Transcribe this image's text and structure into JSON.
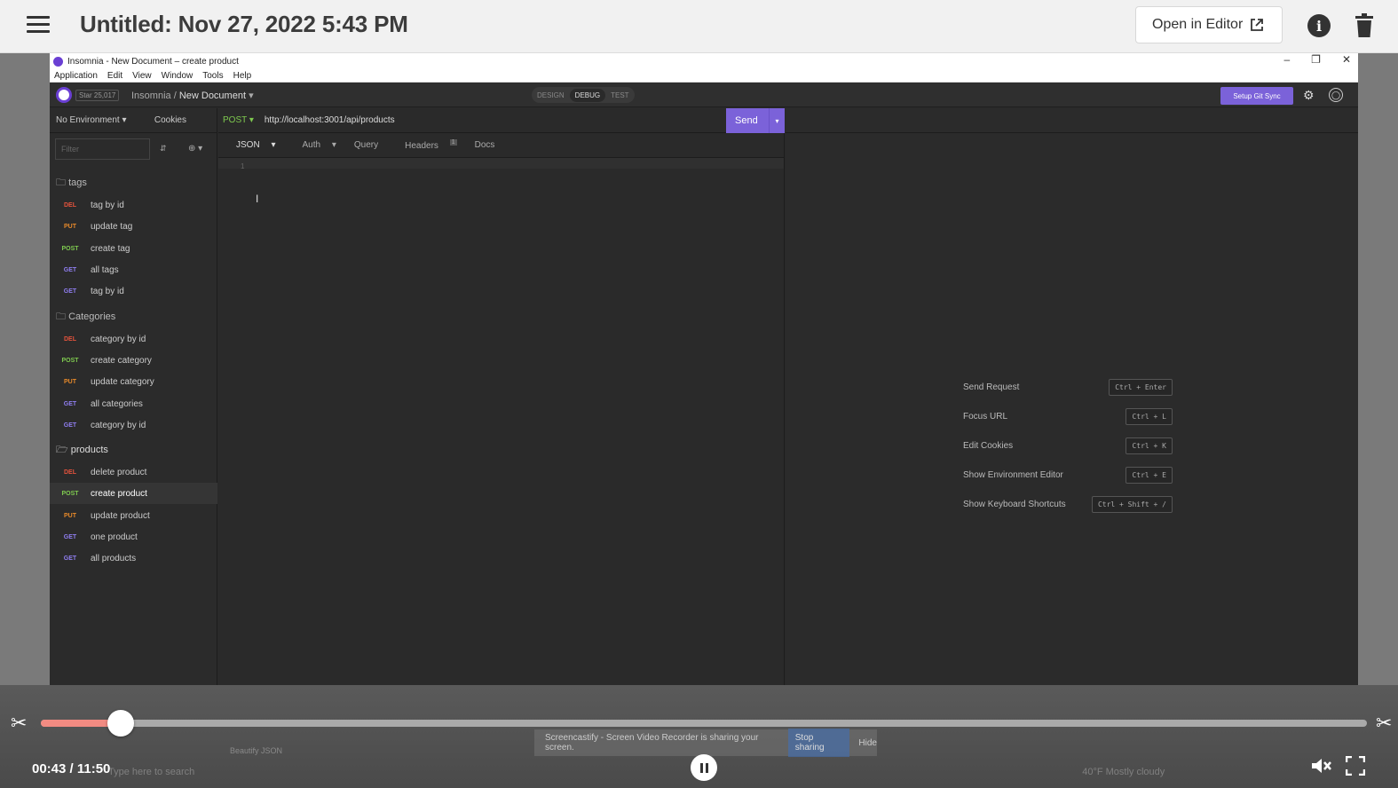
{
  "topbar": {
    "title": "Untitled: Nov 27, 2022 5:43 PM",
    "open_editor_label": "Open in Editor"
  },
  "window": {
    "title": "Insomnia - New Document – create product",
    "menu": [
      "Application",
      "Edit",
      "View",
      "Window",
      "Tools",
      "Help"
    ],
    "star_badge": "Star  25,017",
    "breadcrumb_root": "Insomnia",
    "breadcrumb_doc": "New Document",
    "modes": [
      "DESIGN",
      "DEBUG",
      "TEST"
    ],
    "git_sync": "Setup Git Sync"
  },
  "sidebar": {
    "environment": "No Environment",
    "cookies": "Cookies",
    "filter_placeholder": "Filter",
    "folders": [
      {
        "name": "tags",
        "requests": [
          {
            "method": "DEL",
            "name": "tag by id"
          },
          {
            "method": "PUT",
            "name": "update tag"
          },
          {
            "method": "POST",
            "name": "create tag"
          },
          {
            "method": "GET",
            "name": "all tags"
          },
          {
            "method": "GET",
            "name": "tag by id"
          }
        ]
      },
      {
        "name": "Categories",
        "requests": [
          {
            "method": "DEL",
            "name": "category by id"
          },
          {
            "method": "POST",
            "name": "create category"
          },
          {
            "method": "PUT",
            "name": "update category"
          },
          {
            "method": "GET",
            "name": "all categories"
          },
          {
            "method": "GET",
            "name": "category by id"
          }
        ]
      },
      {
        "name": "products",
        "requests": [
          {
            "method": "DEL",
            "name": "delete product"
          },
          {
            "method": "POST",
            "name": "create product",
            "selected": true
          },
          {
            "method": "PUT",
            "name": "update product"
          },
          {
            "method": "GET",
            "name": "one product"
          },
          {
            "method": "GET",
            "name": "all products"
          }
        ]
      }
    ]
  },
  "request": {
    "method": "POST",
    "url": "http://localhost:3001/api/products",
    "send_label": "Send",
    "tabs": [
      "JSON",
      "Auth",
      "Query",
      "Headers",
      "Docs"
    ],
    "headers_count": "1",
    "line_number": "1"
  },
  "shortcuts": [
    {
      "label": "Send Request",
      "keys": "Ctrl + Enter"
    },
    {
      "label": "Focus URL",
      "keys": "Ctrl + L"
    },
    {
      "label": "Edit Cookies",
      "keys": "Ctrl + K"
    },
    {
      "label": "Show Environment Editor",
      "keys": "Ctrl + E"
    },
    {
      "label": "Show Keyboard Shortcuts",
      "keys": "Ctrl + Shift + /"
    }
  ],
  "player": {
    "time": "00:43 / 11:50",
    "progress": 0.06
  },
  "background": {
    "beautify": "Beautify JSON",
    "share_text": "Screencastify - Screen Video Recorder is sharing your screen.",
    "stop_sharing": "Stop sharing",
    "hide": "Hide",
    "search_placeholder": "Type here to search",
    "weather": "40°F  Mostly cloudy"
  },
  "colors": {
    "accent": "#7b62d9",
    "progress": "#f28b82",
    "del": "#e5533d",
    "put": "#e88a2a",
    "post": "#7ec94f",
    "get": "#8f7ef0"
  }
}
